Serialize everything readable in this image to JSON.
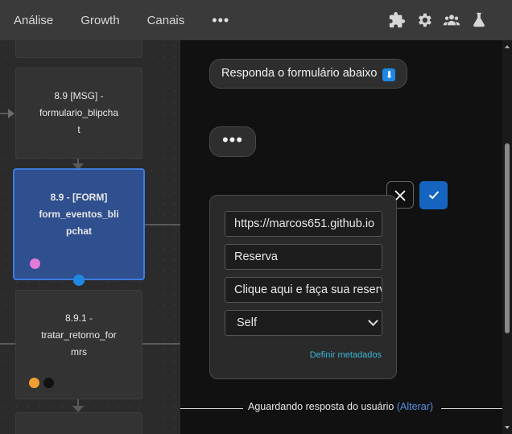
{
  "nav": {
    "items": [
      "Análise",
      "Growth",
      "Canais"
    ],
    "more": "•••",
    "icons": [
      "puzzle-icon",
      "gear-icon",
      "team-icon",
      "flask-icon"
    ]
  },
  "canvas": {
    "nodes": [
      {
        "id": "8.9 [MSG] -",
        "line2": "formulario_blipcha",
        "line3": "t"
      },
      {
        "id": "8.9 - [FORM]",
        "line2": "form_eventos_bli",
        "line3": "pchat",
        "selected": true
      },
      {
        "id": "8.9.1 -",
        "line2": "tratar_retorno_for",
        "line3": "mrs"
      }
    ],
    "colors": {
      "selected_fill": "#2f4f8e",
      "selected_border": "#3d7be0",
      "dot_pink": "#e27ad8",
      "dot_orange": "#f0a030",
      "dot_black": "#111111",
      "connector": "#1e88e5"
    }
  },
  "chat": {
    "message": "Responda o formulário abaixo",
    "typing": "•••",
    "form": {
      "field_url": "https://marcos651.github.io",
      "field_title": "Reserva",
      "field_action": "Clique aqui e faça sua reserva",
      "select_value": "Self",
      "metadata_link": "Definir metadados"
    },
    "status_text": "Aguardando resposta do usuário",
    "status_change": "(Alterar)"
  }
}
